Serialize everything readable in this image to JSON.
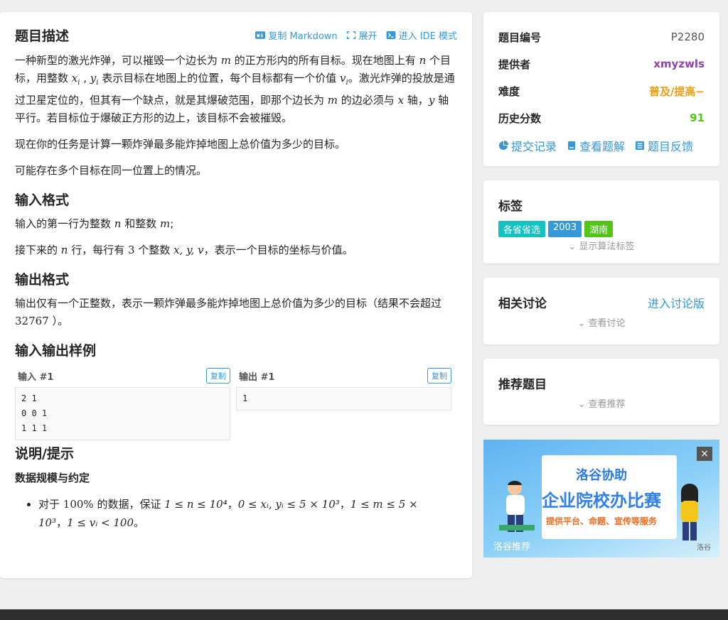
{
  "problem": {
    "title": "题目描述",
    "actions": {
      "copy_markdown": "复制 Markdown",
      "expand": "展开",
      "ide": "进入 IDE 模式"
    },
    "desc": {
      "p1_a": "一种新型的激光炸弹，可以摧毁一个边长为 ",
      "m": "m",
      "p1_b": " 的正方形内的所有目标。现在地图上有 ",
      "n": "n",
      "p1_c": " 个目标，用整数 ",
      "xi": "x",
      "i": "i",
      "comma": " , ",
      "yi": "y",
      "p1_d": " 表示目标在地图上的位置，每个目标都有一个价值 ",
      "vi": "v",
      "p1_e": "。激光炸弹的投放是通过卫星定位的，但其有一个缺点，就是其爆破范围，即那个边长为 ",
      "p1_f": " 的边必须与 ",
      "x": "x",
      "p1_g": " 轴，",
      "y": "y",
      "p1_h": " 轴平行。若目标位于爆破正方形的边上，该目标不会被摧毁。",
      "p2": "现在你的任务是计算一颗炸弹最多能炸掉地图上总价值为多少的目标。",
      "p3": "可能存在多个目标在同一位置上的情况。"
    },
    "input_title": "输入格式",
    "input": {
      "a": "输入的第一行为整数 ",
      "b": " 和整数 ",
      "c": ";",
      "d": "接下来的 ",
      "e": " 行，每行有 ",
      "three": "3",
      "f": " 个整数 ",
      "xyv": "x, y, v",
      "g": "，表示一个目标的坐标与价值。"
    },
    "output_title": "输出格式",
    "output": {
      "a": "输出仅有一个正整数，表示一颗炸弹最多能炸掉地图上总价值为多少的目标（结果不会超过 ",
      "num": "32767",
      "b": " ）。"
    },
    "samples_title": "输入输出样例",
    "sample_in_label": "输入 #1",
    "sample_out_label": "输出 #1",
    "copy_label": "复制",
    "sample_in": "2 1\n0 0 1\n1 1 1",
    "sample_out": "1",
    "hint_title": "说明/提示",
    "hint_sub": "数据规模与约定",
    "hint_a": "对于 ",
    "hint_pct": "100%",
    "hint_b": " 的数据，保证 ",
    "hint_f1": "1 ≤ n ≤ 10⁴",
    "hint_sep": "，",
    "hint_f2": "0 ≤ xᵢ, yᵢ ≤ 5 × 10³",
    "hint_f3": "1 ≤ m ≤ 5 ×",
    "hint_f3b": "10³",
    "hint_f4": "1 ≤ vᵢ < 100",
    "hint_end": "。"
  },
  "info": {
    "id_label": "题目编号",
    "id_value": "P2280",
    "provider_label": "提供者",
    "provider_value": "xmyzwls",
    "difficulty_label": "难度",
    "difficulty_value": "普及/提高−",
    "score_label": "历史分数",
    "score_value": "91",
    "submissions": "提交记录",
    "solutions": "查看题解",
    "feedback": "题目反馈",
    "colors": {
      "provider": "#8e44ad",
      "difficulty": "#f39c11",
      "score": "#52c41a",
      "link": "#3498db"
    }
  },
  "tags": {
    "title": "标签",
    "items": [
      {
        "label": "各省省选",
        "color": "#13c2c2"
      },
      {
        "label": "2003",
        "color": "#3498db"
      },
      {
        "label": "湖南",
        "color": "#52c41a"
      }
    ],
    "show_algo": "显示算法标签"
  },
  "discuss": {
    "title": "相关讨论",
    "enter": "进入讨论版",
    "view": "查看讨论"
  },
  "recommend": {
    "title": "推荐题目",
    "view": "查看推荐"
  },
  "ad": {
    "line1": "洛谷协助",
    "line2": "企业院校办比赛",
    "line3": "提供平台、命题、宣传等服务",
    "footer": "洛谷推荐",
    "brand": "洛谷",
    "close": "×"
  }
}
